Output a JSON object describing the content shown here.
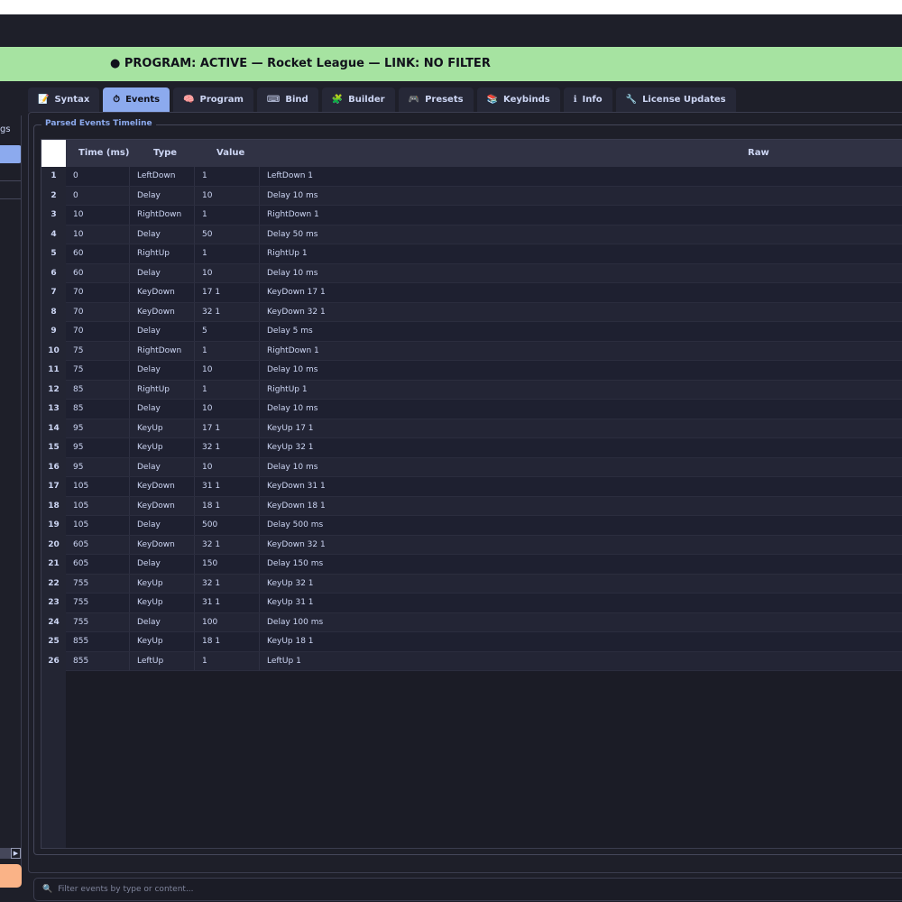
{
  "status": {
    "text": "● PROGRAM: ACTIVE — Rocket League — LINK: NO FILTER"
  },
  "left_panel": {
    "label": "gs"
  },
  "tabs": [
    {
      "icon": "📝",
      "label": "Syntax",
      "active": false
    },
    {
      "icon": "⏱",
      "label": "Events",
      "active": true
    },
    {
      "icon": "🧠",
      "label": "Program",
      "active": false
    },
    {
      "icon": "⌨",
      "label": "Bind",
      "active": false
    },
    {
      "icon": "🧩",
      "label": "Builder",
      "active": false
    },
    {
      "icon": "🎮",
      "label": "Presets",
      "active": false
    },
    {
      "icon": "📚",
      "label": "Keybinds",
      "active": false
    },
    {
      "icon": "ℹ",
      "label": "Info",
      "active": false
    },
    {
      "icon": "🔧",
      "label": "License  Updates",
      "active": false
    }
  ],
  "events_panel": {
    "title": "Parsed Events Timeline",
    "columns": [
      "Time (ms)",
      "Type",
      "Value",
      "Raw"
    ],
    "rows": [
      {
        "num": "1",
        "time": "0",
        "type": "LeftDown",
        "value": "1",
        "raw": "LeftDown 1"
      },
      {
        "num": "2",
        "time": "0",
        "type": "Delay",
        "value": "10",
        "raw": "Delay 10 ms"
      },
      {
        "num": "3",
        "time": "10",
        "type": "RightDown",
        "value": "1",
        "raw": "RightDown 1"
      },
      {
        "num": "4",
        "time": "10",
        "type": "Delay",
        "value": "50",
        "raw": "Delay 50 ms"
      },
      {
        "num": "5",
        "time": "60",
        "type": "RightUp",
        "value": "1",
        "raw": "RightUp 1"
      },
      {
        "num": "6",
        "time": "60",
        "type": "Delay",
        "value": "10",
        "raw": "Delay 10 ms"
      },
      {
        "num": "7",
        "time": "70",
        "type": "KeyDown",
        "value": "17 1",
        "raw": "KeyDown 17 1"
      },
      {
        "num": "8",
        "time": "70",
        "type": "KeyDown",
        "value": "32 1",
        "raw": "KeyDown 32 1"
      },
      {
        "num": "9",
        "time": "70",
        "type": "Delay",
        "value": "5",
        "raw": "Delay 5 ms"
      },
      {
        "num": "10",
        "time": "75",
        "type": "RightDown",
        "value": "1",
        "raw": "RightDown 1"
      },
      {
        "num": "11",
        "time": "75",
        "type": "Delay",
        "value": "10",
        "raw": "Delay 10 ms"
      },
      {
        "num": "12",
        "time": "85",
        "type": "RightUp",
        "value": "1",
        "raw": "RightUp 1"
      },
      {
        "num": "13",
        "time": "85",
        "type": "Delay",
        "value": "10",
        "raw": "Delay 10 ms"
      },
      {
        "num": "14",
        "time": "95",
        "type": "KeyUp",
        "value": "17 1",
        "raw": "KeyUp 17 1"
      },
      {
        "num": "15",
        "time": "95",
        "type": "KeyUp",
        "value": "32 1",
        "raw": "KeyUp 32 1"
      },
      {
        "num": "16",
        "time": "95",
        "type": "Delay",
        "value": "10",
        "raw": "Delay 10 ms"
      },
      {
        "num": "17",
        "time": "105",
        "type": "KeyDown",
        "value": "31 1",
        "raw": "KeyDown 31 1"
      },
      {
        "num": "18",
        "time": "105",
        "type": "KeyDown",
        "value": "18 1",
        "raw": "KeyDown 18 1"
      },
      {
        "num": "19",
        "time": "105",
        "type": "Delay",
        "value": "500",
        "raw": "Delay 500 ms"
      },
      {
        "num": "20",
        "time": "605",
        "type": "KeyDown",
        "value": "32 1",
        "raw": "KeyDown 32 1"
      },
      {
        "num": "21",
        "time": "605",
        "type": "Delay",
        "value": "150",
        "raw": "Delay 150 ms"
      },
      {
        "num": "22",
        "time": "755",
        "type": "KeyUp",
        "value": "32 1",
        "raw": "KeyUp 32 1"
      },
      {
        "num": "23",
        "time": "755",
        "type": "KeyUp",
        "value": "31 1",
        "raw": "KeyUp 31 1"
      },
      {
        "num": "24",
        "time": "755",
        "type": "Delay",
        "value": "100",
        "raw": "Delay 100 ms"
      },
      {
        "num": "25",
        "time": "855",
        "type": "KeyUp",
        "value": "18 1",
        "raw": "KeyUp 18 1"
      },
      {
        "num": "26",
        "time": "855",
        "type": "LeftUp",
        "value": "1",
        "raw": "LeftUp 1"
      }
    ]
  },
  "filter": {
    "icon": "🔍",
    "placeholder": "Filter events by type or content..."
  },
  "colors": {
    "status_bg": "#a6e3a1",
    "accent": "#8caaee",
    "action": "#fab387",
    "background": "#1e1f29"
  },
  "icons": {
    "filter": "search-icon",
    "scroll": "arrow-right-icon"
  }
}
